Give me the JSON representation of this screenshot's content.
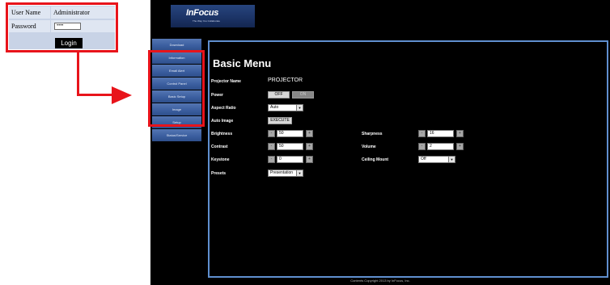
{
  "login": {
    "user_name_label": "User Name",
    "user_name_value": "Administrator",
    "password_label": "Password",
    "password_value": "••••",
    "login_button": "Login"
  },
  "header": {
    "logo_text": "InFocus",
    "logo_tagline": "The Way You Collaborate"
  },
  "nav": {
    "items": [
      {
        "label": "Download"
      },
      {
        "label": "Information"
      },
      {
        "label": "Email Alert"
      },
      {
        "label": "Control Panel"
      },
      {
        "label": "Basic Setup"
      },
      {
        "label": "Image"
      },
      {
        "label": "Setup"
      },
      {
        "label": "Status/Service"
      }
    ]
  },
  "main": {
    "title": "Basic Menu",
    "projector_name_label": "Projector Name",
    "projector_name_value": "PROJECTOR",
    "power_label": "Power",
    "power_off": "OFF",
    "power_on": "ON",
    "aspect_ratio_label": "Aspect Ratio",
    "aspect_ratio_value": "Auto",
    "auto_image_label": "Auto Image",
    "auto_image_button": "EXECUTE",
    "brightness_label": "Brightness",
    "brightness_value": "50",
    "contrast_label": "Contrast",
    "contrast_value": "50",
    "keystone_label": "Keystone",
    "keystone_value": "0",
    "presets_label": "Presets",
    "presets_value": "Presentation",
    "sharpness_label": "Sharpness",
    "sharpness_value": "16",
    "volume_label": "Volume",
    "volume_value": "2",
    "ceiling_mount_label": "Ceiling Mount",
    "ceiling_mount_value": "Off",
    "stepper_minus": "-",
    "stepper_plus": "+"
  },
  "footer": {
    "copyright": "Contents Copyright 2013 by InFocus, Inc."
  },
  "colors": {
    "callout_red": "#e8141b",
    "frame_blue": "#5f8fcf",
    "nav_blue": "#3a5d9e"
  }
}
